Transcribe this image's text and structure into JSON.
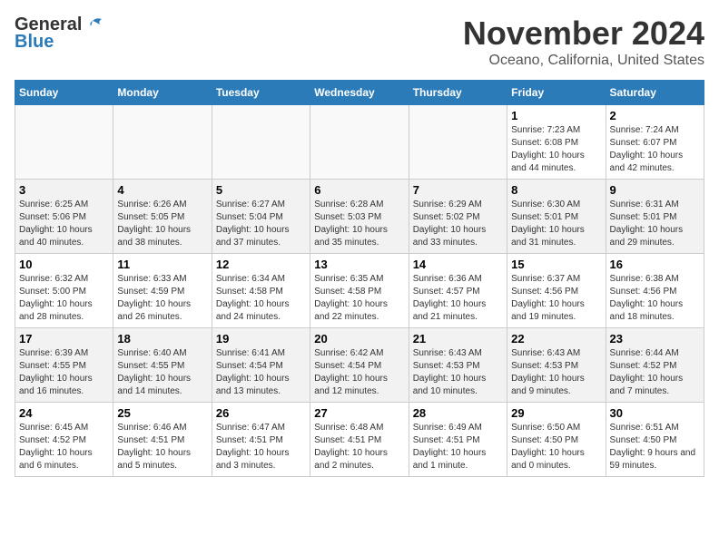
{
  "header": {
    "logo_general": "General",
    "logo_blue": "Blue",
    "month": "November 2024",
    "location": "Oceano, California, United States"
  },
  "weekdays": [
    "Sunday",
    "Monday",
    "Tuesday",
    "Wednesday",
    "Thursday",
    "Friday",
    "Saturday"
  ],
  "weeks": [
    [
      {
        "day": "",
        "sunrise": "",
        "sunset": "",
        "daylight": "",
        "empty": true
      },
      {
        "day": "",
        "sunrise": "",
        "sunset": "",
        "daylight": "",
        "empty": true
      },
      {
        "day": "",
        "sunrise": "",
        "sunset": "",
        "daylight": "",
        "empty": true
      },
      {
        "day": "",
        "sunrise": "",
        "sunset": "",
        "daylight": "",
        "empty": true
      },
      {
        "day": "",
        "sunrise": "",
        "sunset": "",
        "daylight": "",
        "empty": true
      },
      {
        "day": "1",
        "sunrise": "Sunrise: 7:23 AM",
        "sunset": "Sunset: 6:08 PM",
        "daylight": "Daylight: 10 hours and 44 minutes.",
        "empty": false
      },
      {
        "day": "2",
        "sunrise": "Sunrise: 7:24 AM",
        "sunset": "Sunset: 6:07 PM",
        "daylight": "Daylight: 10 hours and 42 minutes.",
        "empty": false
      }
    ],
    [
      {
        "day": "3",
        "sunrise": "Sunrise: 6:25 AM",
        "sunset": "Sunset: 5:06 PM",
        "daylight": "Daylight: 10 hours and 40 minutes.",
        "empty": false
      },
      {
        "day": "4",
        "sunrise": "Sunrise: 6:26 AM",
        "sunset": "Sunset: 5:05 PM",
        "daylight": "Daylight: 10 hours and 38 minutes.",
        "empty": false
      },
      {
        "day": "5",
        "sunrise": "Sunrise: 6:27 AM",
        "sunset": "Sunset: 5:04 PM",
        "daylight": "Daylight: 10 hours and 37 minutes.",
        "empty": false
      },
      {
        "day": "6",
        "sunrise": "Sunrise: 6:28 AM",
        "sunset": "Sunset: 5:03 PM",
        "daylight": "Daylight: 10 hours and 35 minutes.",
        "empty": false
      },
      {
        "day": "7",
        "sunrise": "Sunrise: 6:29 AM",
        "sunset": "Sunset: 5:02 PM",
        "daylight": "Daylight: 10 hours and 33 minutes.",
        "empty": false
      },
      {
        "day": "8",
        "sunrise": "Sunrise: 6:30 AM",
        "sunset": "Sunset: 5:01 PM",
        "daylight": "Daylight: 10 hours and 31 minutes.",
        "empty": false
      },
      {
        "day": "9",
        "sunrise": "Sunrise: 6:31 AM",
        "sunset": "Sunset: 5:01 PM",
        "daylight": "Daylight: 10 hours and 29 minutes.",
        "empty": false
      }
    ],
    [
      {
        "day": "10",
        "sunrise": "Sunrise: 6:32 AM",
        "sunset": "Sunset: 5:00 PM",
        "daylight": "Daylight: 10 hours and 28 minutes.",
        "empty": false
      },
      {
        "day": "11",
        "sunrise": "Sunrise: 6:33 AM",
        "sunset": "Sunset: 4:59 PM",
        "daylight": "Daylight: 10 hours and 26 minutes.",
        "empty": false
      },
      {
        "day": "12",
        "sunrise": "Sunrise: 6:34 AM",
        "sunset": "Sunset: 4:58 PM",
        "daylight": "Daylight: 10 hours and 24 minutes.",
        "empty": false
      },
      {
        "day": "13",
        "sunrise": "Sunrise: 6:35 AM",
        "sunset": "Sunset: 4:58 PM",
        "daylight": "Daylight: 10 hours and 22 minutes.",
        "empty": false
      },
      {
        "day": "14",
        "sunrise": "Sunrise: 6:36 AM",
        "sunset": "Sunset: 4:57 PM",
        "daylight": "Daylight: 10 hours and 21 minutes.",
        "empty": false
      },
      {
        "day": "15",
        "sunrise": "Sunrise: 6:37 AM",
        "sunset": "Sunset: 4:56 PM",
        "daylight": "Daylight: 10 hours and 19 minutes.",
        "empty": false
      },
      {
        "day": "16",
        "sunrise": "Sunrise: 6:38 AM",
        "sunset": "Sunset: 4:56 PM",
        "daylight": "Daylight: 10 hours and 18 minutes.",
        "empty": false
      }
    ],
    [
      {
        "day": "17",
        "sunrise": "Sunrise: 6:39 AM",
        "sunset": "Sunset: 4:55 PM",
        "daylight": "Daylight: 10 hours and 16 minutes.",
        "empty": false
      },
      {
        "day": "18",
        "sunrise": "Sunrise: 6:40 AM",
        "sunset": "Sunset: 4:55 PM",
        "daylight": "Daylight: 10 hours and 14 minutes.",
        "empty": false
      },
      {
        "day": "19",
        "sunrise": "Sunrise: 6:41 AM",
        "sunset": "Sunset: 4:54 PM",
        "daylight": "Daylight: 10 hours and 13 minutes.",
        "empty": false
      },
      {
        "day": "20",
        "sunrise": "Sunrise: 6:42 AM",
        "sunset": "Sunset: 4:54 PM",
        "daylight": "Daylight: 10 hours and 12 minutes.",
        "empty": false
      },
      {
        "day": "21",
        "sunrise": "Sunrise: 6:43 AM",
        "sunset": "Sunset: 4:53 PM",
        "daylight": "Daylight: 10 hours and 10 minutes.",
        "empty": false
      },
      {
        "day": "22",
        "sunrise": "Sunrise: 6:43 AM",
        "sunset": "Sunset: 4:53 PM",
        "daylight": "Daylight: 10 hours and 9 minutes.",
        "empty": false
      },
      {
        "day": "23",
        "sunrise": "Sunrise: 6:44 AM",
        "sunset": "Sunset: 4:52 PM",
        "daylight": "Daylight: 10 hours and 7 minutes.",
        "empty": false
      }
    ],
    [
      {
        "day": "24",
        "sunrise": "Sunrise: 6:45 AM",
        "sunset": "Sunset: 4:52 PM",
        "daylight": "Daylight: 10 hours and 6 minutes.",
        "empty": false
      },
      {
        "day": "25",
        "sunrise": "Sunrise: 6:46 AM",
        "sunset": "Sunset: 4:51 PM",
        "daylight": "Daylight: 10 hours and 5 minutes.",
        "empty": false
      },
      {
        "day": "26",
        "sunrise": "Sunrise: 6:47 AM",
        "sunset": "Sunset: 4:51 PM",
        "daylight": "Daylight: 10 hours and 3 minutes.",
        "empty": false
      },
      {
        "day": "27",
        "sunrise": "Sunrise: 6:48 AM",
        "sunset": "Sunset: 4:51 PM",
        "daylight": "Daylight: 10 hours and 2 minutes.",
        "empty": false
      },
      {
        "day": "28",
        "sunrise": "Sunrise: 6:49 AM",
        "sunset": "Sunset: 4:51 PM",
        "daylight": "Daylight: 10 hours and 1 minute.",
        "empty": false
      },
      {
        "day": "29",
        "sunrise": "Sunrise: 6:50 AM",
        "sunset": "Sunset: 4:50 PM",
        "daylight": "Daylight: 10 hours and 0 minutes.",
        "empty": false
      },
      {
        "day": "30",
        "sunrise": "Sunrise: 6:51 AM",
        "sunset": "Sunset: 4:50 PM",
        "daylight": "Daylight: 9 hours and 59 minutes.",
        "empty": false
      }
    ]
  ]
}
